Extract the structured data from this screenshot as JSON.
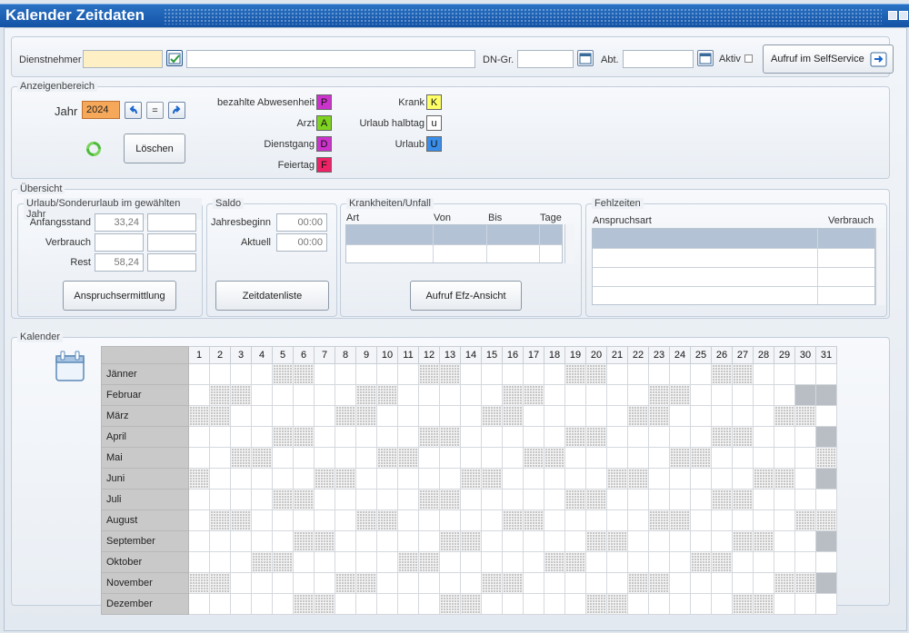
{
  "window": {
    "title": "Kalender Zeitdaten"
  },
  "top": {
    "dienstnehmer_label": "Dienstnehmer",
    "dngr_label": "DN-Gr.",
    "abt_label": "Abt.",
    "aktiv_label": "Aktiv",
    "selfservice_button": "Aufruf im SelfService"
  },
  "anzeige": {
    "legend": "Anzeigenbereich",
    "jahr_label": "Jahr",
    "jahr_value": "2024",
    "eq_label": "=",
    "loeschen_button": "Löschen",
    "codes_left": [
      {
        "label": "bezahlte Abwesenheit",
        "code": "P",
        "color": "#cc33cc"
      },
      {
        "label": "Arzt",
        "code": "A",
        "color": "#7ed321"
      },
      {
        "label": "Dienstgang",
        "code": "D",
        "color": "#cc33cc"
      },
      {
        "label": "Feiertag",
        "code": "F",
        "color": "#ee2266"
      }
    ],
    "codes_right": [
      {
        "label": "Krank",
        "code": "K",
        "color": "#ffff66"
      },
      {
        "label": "Urlaub halbtag",
        "code": "u",
        "color": "#ffffff"
      },
      {
        "label": "Urlaub",
        "code": "U",
        "color": "#3a8de8"
      }
    ]
  },
  "uebersicht": {
    "legend": "Übersicht",
    "urlaub": {
      "legend": "Urlaub/Sonderurlaub im gewählten Jahr",
      "anfang_label": "Anfangsstand",
      "anfang_value": "33,24",
      "verbrauch_label": "Verbrauch",
      "rest_label": "Rest",
      "rest_value": "58,24",
      "button": "Anspruchsermittlung"
    },
    "saldo": {
      "legend": "Saldo",
      "jahresbeginn_label": "Jahresbeginn",
      "jahresbeginn_value": "00:00",
      "aktuell_label": "Aktuell",
      "aktuell_value": "00:00",
      "button": "Zeitdatenliste"
    },
    "krank": {
      "legend": "Krankheiten/Unfall",
      "col_art": "Art",
      "col_von": "Von",
      "col_bis": "Bis",
      "col_tage": "Tage",
      "button": "Aufruf Efz-Ansicht"
    },
    "fehl": {
      "legend": "Fehlzeiten",
      "col_anspruch": "Anspruchsart",
      "col_verbrauch": "Verbrauch"
    }
  },
  "kalender": {
    "legend": "Kalender",
    "days": [
      "1",
      "2",
      "3",
      "4",
      "5",
      "6",
      "7",
      "8",
      "9",
      "10",
      "11",
      "12",
      "13",
      "14",
      "15",
      "16",
      "17",
      "18",
      "19",
      "20",
      "21",
      "22",
      "23",
      "24",
      "25",
      "26",
      "27",
      "28",
      "29",
      "30",
      "31"
    ],
    "months": [
      {
        "name": "Jänner",
        "days": 31,
        "first_dow": 1
      },
      {
        "name": "Februar",
        "days": 29,
        "first_dow": 4
      },
      {
        "name": "März",
        "days": 31,
        "first_dow": 5
      },
      {
        "name": "April",
        "days": 30,
        "first_dow": 1
      },
      {
        "name": "Mai",
        "days": 31,
        "first_dow": 3
      },
      {
        "name": "Juni",
        "days": 30,
        "first_dow": 6
      },
      {
        "name": "Juli",
        "days": 31,
        "first_dow": 1
      },
      {
        "name": "August",
        "days": 31,
        "first_dow": 4
      },
      {
        "name": "September",
        "days": 30,
        "first_dow": 0
      },
      {
        "name": "Oktober",
        "days": 31,
        "first_dow": 2
      },
      {
        "name": "November",
        "days": 30,
        "first_dow": 5
      },
      {
        "name": "Dezember",
        "days": 31,
        "first_dow": 0
      }
    ]
  }
}
